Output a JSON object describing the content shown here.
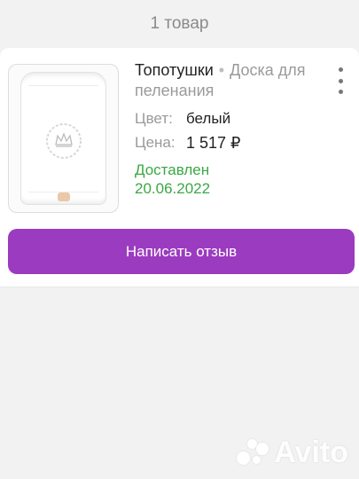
{
  "header": {
    "count_label": "1 товар"
  },
  "product": {
    "brand": "Топотушки",
    "separator": "•",
    "name": "Доска для пеленания",
    "color_label": "Цвет:",
    "color_value": "белый",
    "price_label": "Цена:",
    "price_value": "1 517 ₽",
    "status": "Доставлен",
    "status_date": "20.06.2022",
    "image_icon": "changing-board-image"
  },
  "actions": {
    "review_label": "Написать отзыв",
    "more_icon": "vertical-dots-icon"
  },
  "watermark": {
    "text": "Avito"
  },
  "colors": {
    "accent": "#9b3bc0",
    "status_green": "#3aa845",
    "background": "#f2f2f2"
  }
}
